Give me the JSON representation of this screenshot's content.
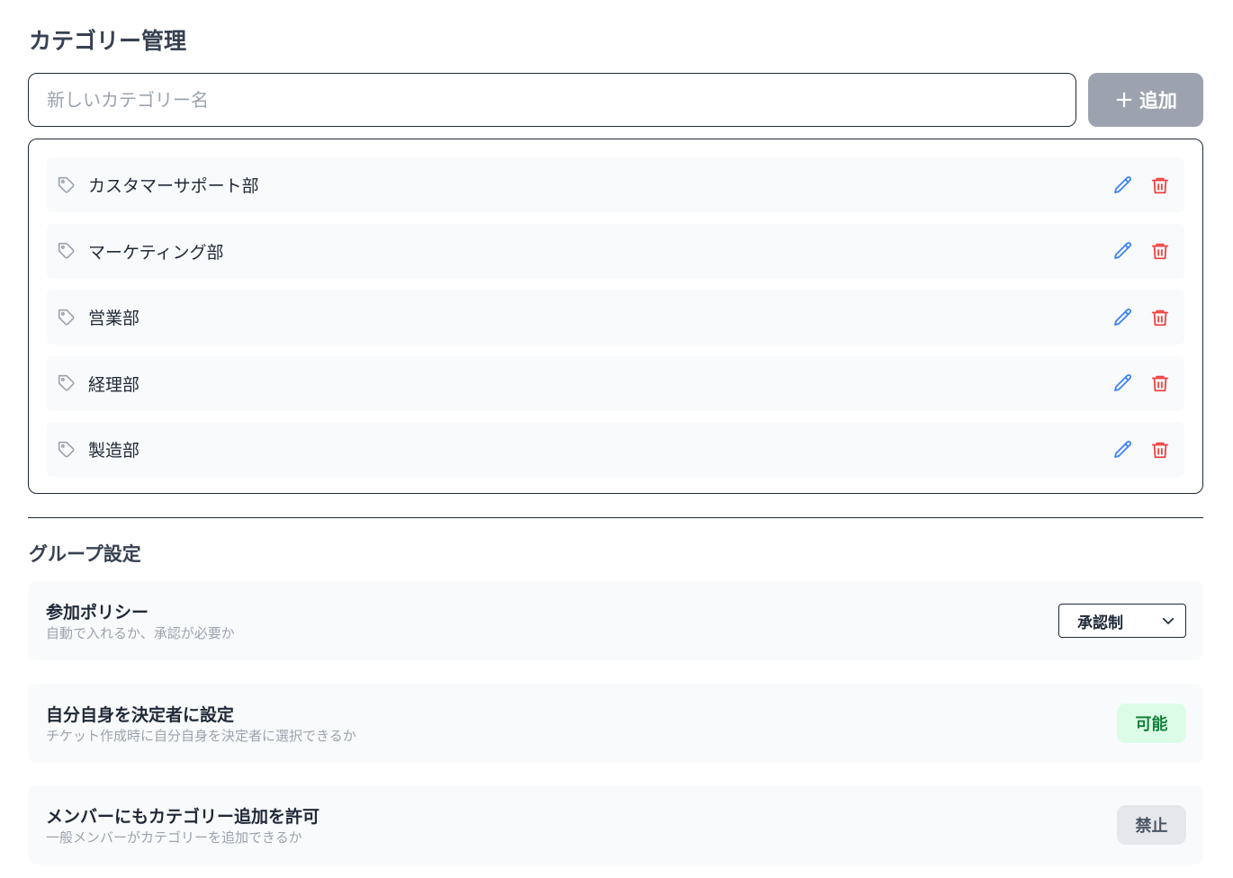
{
  "category_section": {
    "title": "カテゴリー管理",
    "input_placeholder": "新しいカテゴリー名",
    "add_button_label": "追加",
    "items": [
      {
        "label": "カスタマーサポート部"
      },
      {
        "label": "マーケティング部"
      },
      {
        "label": "営業部"
      },
      {
        "label": "経理部"
      },
      {
        "label": "製造部"
      }
    ]
  },
  "group_section": {
    "title": "グループ設定",
    "settings": [
      {
        "title": "参加ポリシー",
        "description": "自動で入れるか、承認が必要か",
        "control": "select",
        "value": "承認制"
      },
      {
        "title": "自分自身を決定者に設定",
        "description": "チケット作成時に自分自身を決定者に選択できるか",
        "control": "badge",
        "value": "可能",
        "state": "on"
      },
      {
        "title": "メンバーにもカテゴリー追加を許可",
        "description": "一般メンバーがカテゴリーを追加できるか",
        "control": "badge",
        "value": "禁止",
        "state": "off"
      }
    ]
  },
  "icons": {
    "tag": "tag-icon",
    "edit": "pencil-icon",
    "delete": "trash-icon",
    "add": "plus-icon",
    "dropdown": "chevron-down-icon"
  },
  "colors": {
    "edit_icon": "#3b82f6",
    "delete_icon": "#ef4444",
    "add_button_bg": "#9ca3af",
    "badge_on_bg": "#dcfce7",
    "badge_on_text": "#15803d",
    "badge_off_bg": "#e5e7eb",
    "badge_off_text": "#4b5563"
  }
}
